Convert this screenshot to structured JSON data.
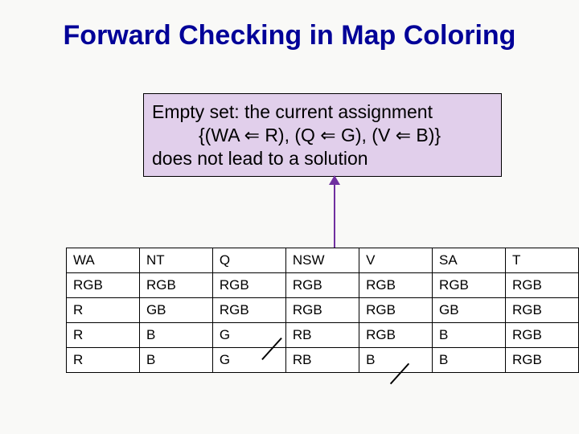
{
  "title": "Forward Checking in Map Coloring",
  "callout": {
    "line1": "Empty set: the current assignment",
    "line2": "{(WA ⇐ R), (Q ⇐ G), (V ⇐ B)}",
    "line3": "does not lead to a solution"
  },
  "table": {
    "headers": [
      "WA",
      "NT",
      "Q",
      "NSW",
      "V",
      "SA",
      "T"
    ],
    "rows": [
      [
        "RGB",
        "RGB",
        "RGB",
        "RGB",
        "RGB",
        "RGB",
        "RGB"
      ],
      [
        "R",
        "GB",
        "RGB",
        "RGB",
        "RGB",
        "GB",
        "RGB"
      ],
      [
        "R",
        "B",
        "G",
        "RB",
        "RGB",
        "B",
        "RGB"
      ],
      [
        "R",
        "B",
        "G",
        "RB",
        "B",
        "B",
        "RGB"
      ]
    ]
  }
}
